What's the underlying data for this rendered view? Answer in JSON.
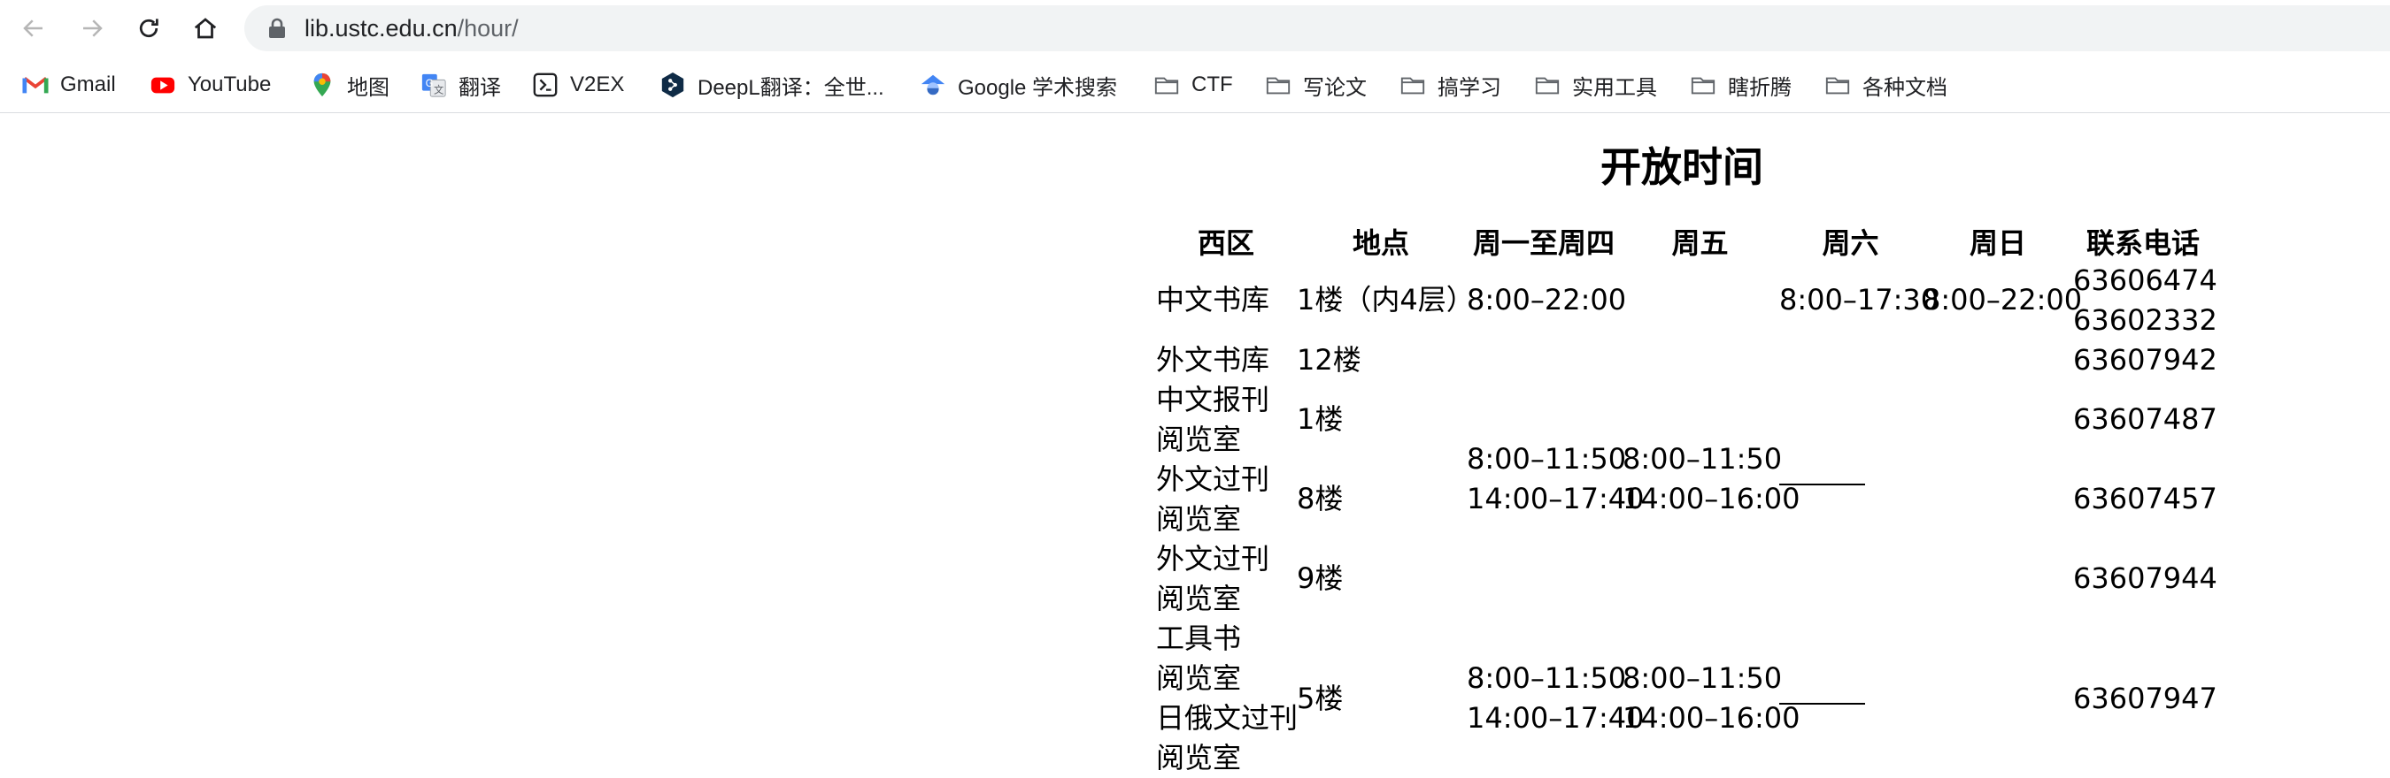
{
  "browser": {
    "url_host": "lib.ustc.edu.cn",
    "url_path": "/hour/"
  },
  "bookmarks": [
    {
      "label": "Gmail",
      "icon": "gmail-icon"
    },
    {
      "label": "YouTube",
      "icon": "youtube-icon"
    },
    {
      "label": "地图",
      "icon": "maps-icon"
    },
    {
      "label": "翻译",
      "icon": "translate-icon"
    },
    {
      "label": "V2EX",
      "icon": "v2ex-icon"
    },
    {
      "label": "DeepL翻译：全世...",
      "icon": "deepl-icon"
    },
    {
      "label": "Google 学术搜索",
      "icon": "scholar-icon"
    },
    {
      "label": "CTF",
      "icon": "folder-icon"
    },
    {
      "label": "写论文",
      "icon": "folder-icon"
    },
    {
      "label": "搞学习",
      "icon": "folder-icon"
    },
    {
      "label": "实用工具",
      "icon": "folder-icon"
    },
    {
      "label": "瞎折腾",
      "icon": "folder-icon"
    },
    {
      "label": "各种文档",
      "icon": "folder-icon"
    }
  ],
  "page": {
    "title": "开放时间",
    "headers": [
      "西区",
      "地点",
      "周一至周四",
      "周五",
      "周六",
      "周日",
      "联系电话"
    ],
    "rows": {
      "r1": {
        "name": "中文书库",
        "place": "1楼（内4层）",
        "weekday": "8:00–22:00",
        "sat": "8:00–17:30",
        "sun": "8:00–22:00",
        "phone1": "63606474",
        "phone2": "63602332"
      },
      "r2": {
        "name": "外文书库",
        "place": "12楼",
        "phone": "63607942"
      },
      "r3": {
        "name1": "中文报刊",
        "name2": "阅览室",
        "place": "1楼",
        "phone": "63607487"
      },
      "r4": {
        "name1": "外文过刊",
        "name2": "阅览室",
        "place": "8楼",
        "phone": "63607457"
      },
      "r5": {
        "name1": "外文过刊",
        "name2": "阅览室",
        "place": "9楼",
        "phone": "63607944"
      },
      "r6": {
        "name1": "工具书",
        "name2": "阅览室",
        "name3": "日俄文过刊",
        "name4": "阅览室",
        "place": "5楼",
        "phone": "63607947"
      }
    },
    "group_a": {
      "weekday_am": "8:00–11:50",
      "weekday_pm": "14:00–17:40",
      "fri_am": "8:00–11:50",
      "fri_pm": "14:00–16:00"
    },
    "group_b": {
      "weekday_am": "8:00–11:50",
      "weekday_pm": "14:00–17:40",
      "fri_am": "8:00–11:50",
      "fri_pm": "14:00–16:00"
    }
  }
}
